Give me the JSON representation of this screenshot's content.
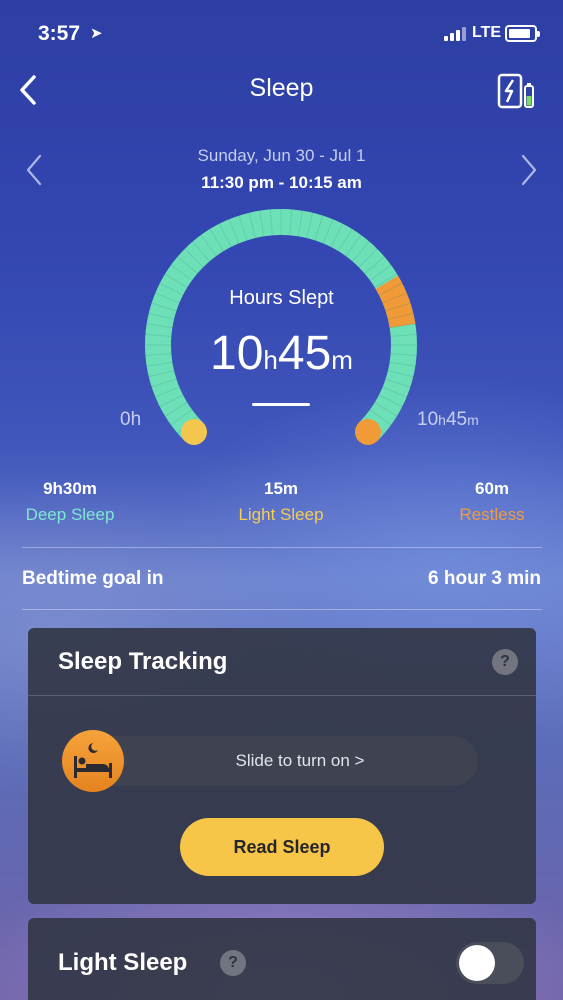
{
  "status_bar": {
    "time": "3:57",
    "network": "LTE"
  },
  "header": {
    "title": "Sleep"
  },
  "date_nav": {
    "date_range": "Sunday, Jun 30 - Jul 1",
    "time_range": "11:30 pm - 10:15 am"
  },
  "gauge": {
    "label": "Hours Slept",
    "hours": "10",
    "hours_unit": "h",
    "minutes": "45",
    "minutes_unit": "m",
    "min_label": "0h",
    "max_hours": "10",
    "max_hours_unit": "h",
    "max_minutes": "45",
    "max_minutes_unit": "m",
    "restless_fraction_start": 0.72,
    "restless_fraction_end": 0.8,
    "colors": {
      "deep": "#6ee0b8",
      "light": "#f4c64d",
      "restless": "#f09a38"
    }
  },
  "stats": [
    {
      "value": "9h30m",
      "label": "Deep Sleep",
      "color": "#7ee8d0"
    },
    {
      "value": "15m",
      "label": "Light Sleep",
      "color": "#f5cd52"
    },
    {
      "value": "60m",
      "label": "Restless",
      "color": "#f39b3a"
    }
  ],
  "bedtime": {
    "label": "Bedtime goal in",
    "value": "6 hour 3 min"
  },
  "tracking_card": {
    "title": "Sleep Tracking",
    "help": "?",
    "slider_text": "Slide to turn on >",
    "button_label": "Read Sleep"
  },
  "light_sleep_card": {
    "title": "Light Sleep",
    "help": "?",
    "toggle_on": false
  }
}
